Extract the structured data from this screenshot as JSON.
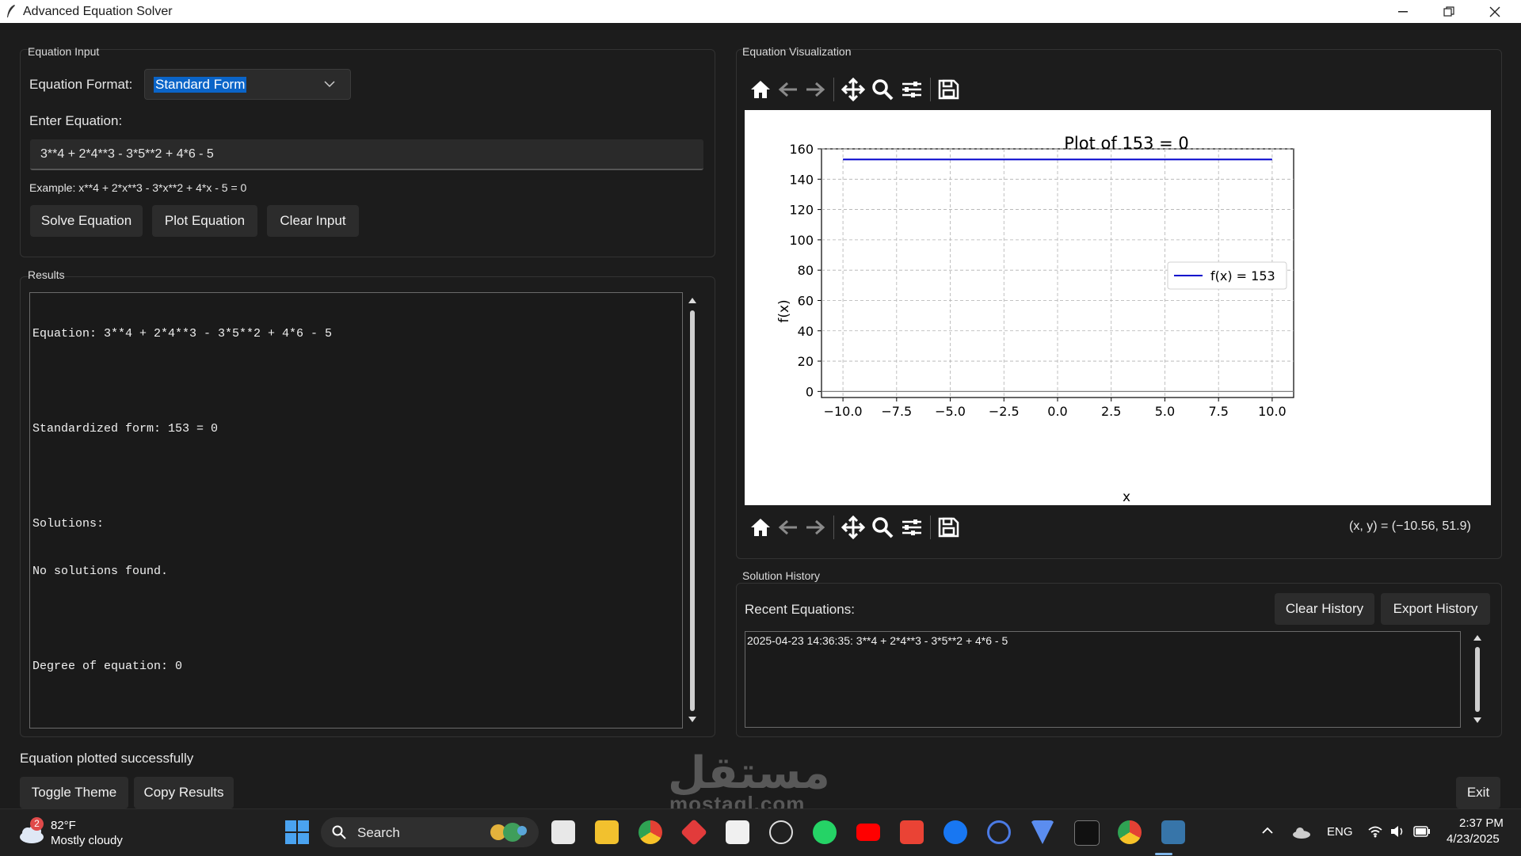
{
  "window": {
    "title": "Advanced Equation Solver"
  },
  "input_panel": {
    "frame_label": "Equation Input",
    "format_label": "Equation Format:",
    "format_value": "Standard Form",
    "enter_label": "Enter Equation:",
    "equation_value": "3**4 + 2*4**3 - 3*5**2 + 4*6 - 5",
    "example": "Example: x**4 + 2*x**3 - 3*x**2 + 4*x - 5 = 0",
    "buttons": {
      "solve": "Solve Equation",
      "plot": "Plot Equation",
      "clear": "Clear Input"
    }
  },
  "results_panel": {
    "frame_label": "Results",
    "lines": [
      "Equation: 3**4 + 2*4**3 - 3*5**2 + 4*6 - 5",
      "",
      "Standardized form: 153 = 0",
      "",
      "Solutions:",
      "No solutions found.",
      "",
      "Degree of equation: 0"
    ]
  },
  "viz_panel": {
    "frame_label": "Equation Visualization",
    "coords": "(x, y) = (−10.56, 51.9)",
    "toolbar_icons": [
      "home-icon",
      "back-arrow-icon",
      "forward-arrow-icon",
      "pan-icon",
      "zoom-icon",
      "configure-icon",
      "save-icon"
    ]
  },
  "chart_data": {
    "type": "line",
    "title": "Plot of 153 = 0",
    "xlabel": "x",
    "ylabel": "f(x)",
    "xlim": [
      -11,
      11
    ],
    "ylim": [
      -4,
      160
    ],
    "xticks": [
      "−10.0",
      "−7.5",
      "−5.0",
      "−2.5",
      "0.0",
      "2.5",
      "5.0",
      "7.5",
      "10.0"
    ],
    "yticks": [
      "0",
      "20",
      "40",
      "60",
      "80",
      "100",
      "120",
      "140",
      "160"
    ],
    "grid": true,
    "legend": "center-right",
    "series": [
      {
        "name": "f(x) = 153",
        "color": "#0000cc",
        "x": [
          -10,
          10
        ],
        "y": [
          153,
          153
        ]
      }
    ],
    "reference_line": {
      "y": 0,
      "color": "#808080"
    }
  },
  "history_panel": {
    "frame_label": "Solution History",
    "recent_label": "Recent Equations:",
    "buttons": {
      "clear": "Clear History",
      "export": "Export History"
    },
    "entries": [
      "2025-04-23 14:36:35: 3**4 + 2*4**3 - 3*5**2 + 4*6 - 5"
    ]
  },
  "status": "Equation plotted successfully",
  "bottom_buttons": {
    "toggle_theme": "Toggle Theme",
    "copy_results": "Copy Results",
    "exit": "Exit"
  },
  "taskbar": {
    "weather_badge": "2",
    "weather_temp": "82°F",
    "weather_desc": "Mostly cloudy",
    "search_label": "Search",
    "lang": "ENG",
    "time": "2:37 PM",
    "date": "4/23/2025",
    "watermark_arabic": "مستقل",
    "watermark_latin": "mostaql.com"
  }
}
